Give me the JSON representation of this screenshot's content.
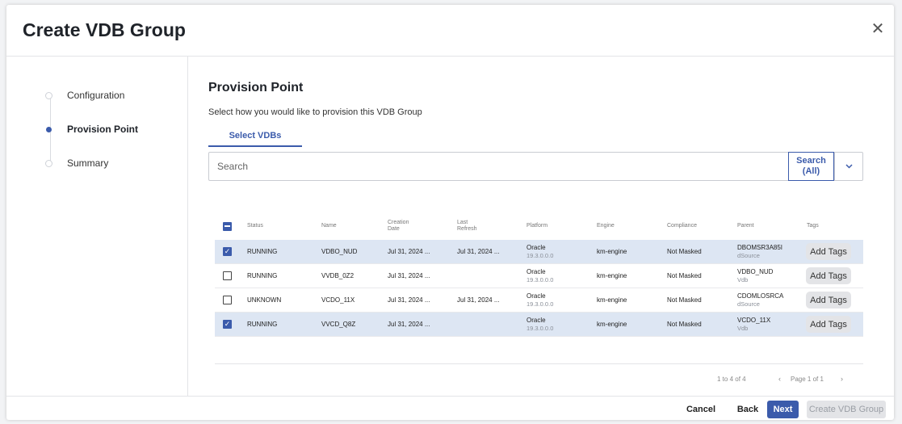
{
  "dialog": {
    "title": "Create VDB Group",
    "close_icon": "close-icon"
  },
  "steps": [
    {
      "label": "Configuration",
      "active": false
    },
    {
      "label": "Provision Point",
      "active": true
    },
    {
      "label": "Summary",
      "active": false
    }
  ],
  "section": {
    "title": "Provision Point",
    "description": "Select how you would like to provision this VDB Group",
    "tab_label": "Select VDBs"
  },
  "search": {
    "placeholder": "Search",
    "scope_label": "Search\n(All)",
    "dropdown_icon": "chevron-down-icon"
  },
  "table": {
    "headers": [
      "Status",
      "Name",
      "Creation Date",
      "Last Refresh",
      "Platform",
      "Engine",
      "Compliance",
      "Parent",
      "Tags"
    ],
    "rows": [
      {
        "selected": true,
        "status": "RUNNING",
        "name": "VDBO_NUD",
        "created": "Jul 31, 2024 ...",
        "refreshed": "Jul 31, 2024 ...",
        "platform": "Oracle",
        "platform_ver": "19.3.0.0.0",
        "engine": "km-engine",
        "compliance": "Not Masked",
        "parent": "DBOMSR3A85I",
        "parent_type": "dSource",
        "tags_label": "Add Tags"
      },
      {
        "selected": false,
        "status": "RUNNING",
        "name": "VVDB_0Z2",
        "created": "Jul 31, 2024 ...",
        "refreshed": "",
        "platform": "Oracle",
        "platform_ver": "19.3.0.0.0",
        "engine": "km-engine",
        "compliance": "Not Masked",
        "parent": "VDBO_NUD",
        "parent_type": "Vdb",
        "tags_label": "Add Tags"
      },
      {
        "selected": false,
        "status": "UNKNOWN",
        "name": "VCDO_11X",
        "created": "Jul 31, 2024 ...",
        "refreshed": "Jul 31, 2024 ...",
        "platform": "Oracle",
        "platform_ver": "19.3.0.0.0",
        "engine": "km-engine",
        "compliance": "Not Masked",
        "parent": "CDOMLOSRCA",
        "parent_type": "dSource",
        "tags_label": "Add Tags"
      },
      {
        "selected": true,
        "status": "RUNNING",
        "name": "VVCD_Q8Z",
        "created": "Jul 31, 2024 ...",
        "refreshed": "",
        "platform": "Oracle",
        "platform_ver": "19.3.0.0.0",
        "engine": "km-engine",
        "compliance": "Not Masked",
        "parent": "VCDO_11X",
        "parent_type": "Vdb",
        "tags_label": "Add Tags"
      }
    ]
  },
  "pagination": {
    "count": "1 to 4 of 4",
    "page": "Page 1 of 1",
    "prev_icon": "chevron-left-icon",
    "next_icon": "chevron-right-icon"
  },
  "footer": {
    "cancel": "Cancel",
    "back": "Back",
    "next": "Next",
    "create": "Create VDB Group"
  },
  "colors": {
    "accent": "#3b5bab",
    "selected_row": "#dde6f3"
  }
}
